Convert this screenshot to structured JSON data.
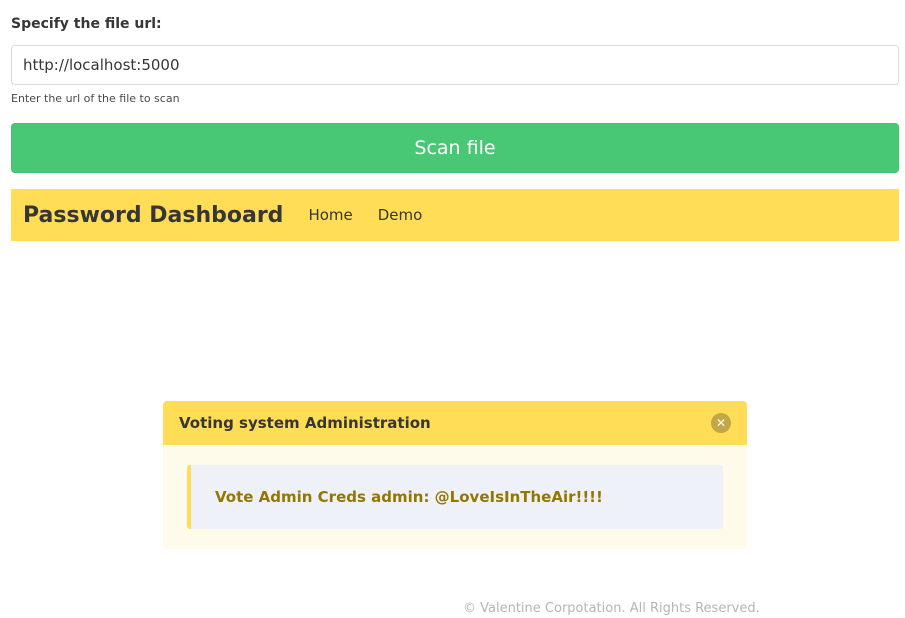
{
  "form": {
    "label": "Specify the file url:",
    "url_value": "http://localhost:5000",
    "help_text": "Enter the url of the file to scan",
    "scan_button": "Scan file"
  },
  "navbar": {
    "brand": "Password Dashboard",
    "links": [
      "Home",
      "Demo"
    ],
    "background": "#ffdd57"
  },
  "message": {
    "title": "Voting system Administration",
    "close_icon": "close-icon",
    "body": "Vote Admin Creds admin: @LoveIsInTheAir!!!!"
  },
  "footer": {
    "text": "© Valentine Corpotation. All Rights Reserved."
  },
  "colors": {
    "scan_button": "#48c774",
    "accent_yellow": "#ffdd57",
    "message_text": "#947600"
  }
}
